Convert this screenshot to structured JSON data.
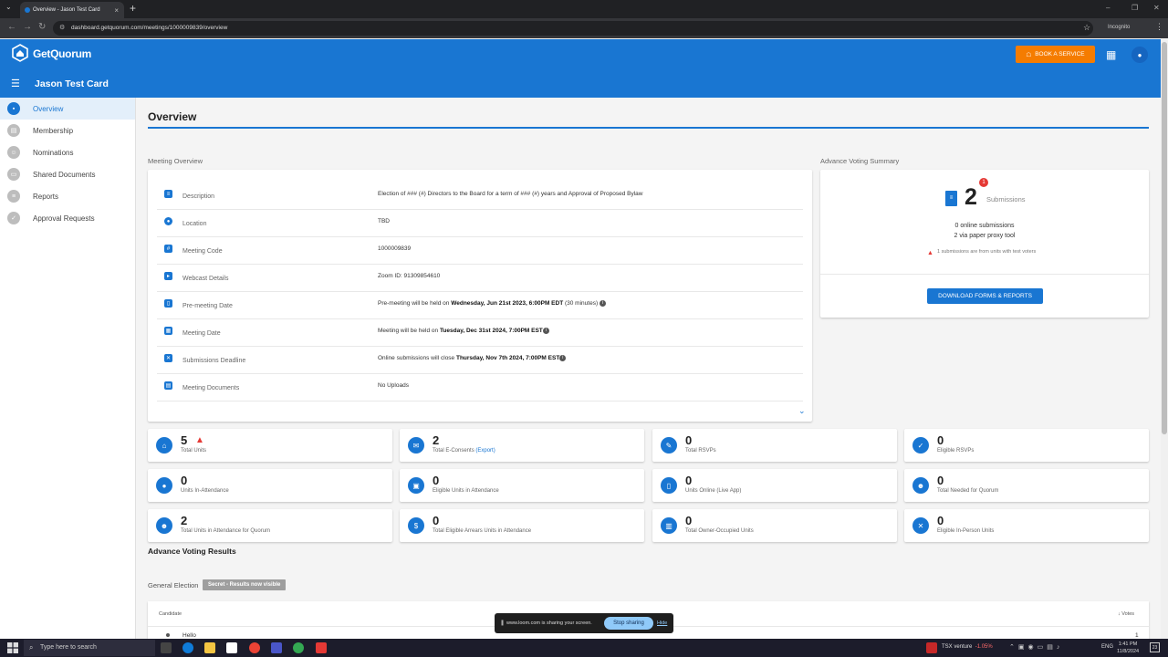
{
  "browser": {
    "tab_title": "Overview - Jason Test Card",
    "url": "dashboard.getquorum.com/meetings/1000009839/overview",
    "incognito_label": "Incognito"
  },
  "app": {
    "brand": "GetQuorum",
    "book_service_label": "BOOK A SERVICE",
    "meeting_title": "Jason Test Card",
    "brand_color": "#1976d2",
    "accent_color": "#f57c00"
  },
  "sidebar": {
    "items": [
      {
        "label": "Overview",
        "icon": "overview-icon",
        "active": true
      },
      {
        "label": "Membership",
        "icon": "membership-icon"
      },
      {
        "label": "Nominations",
        "icon": "nominations-icon"
      },
      {
        "label": "Shared Documents",
        "icon": "documents-icon"
      },
      {
        "label": "Reports",
        "icon": "reports-icon"
      },
      {
        "label": "Approval Requests",
        "icon": "thumbs-up-icon"
      }
    ]
  },
  "page": {
    "title": "Overview",
    "meeting_overview_label": "Meeting Overview",
    "advance_voting_summary_label": "Advance Voting Summary"
  },
  "overview": {
    "rows": [
      {
        "label": "Description",
        "value": "Election of ### (#) Directors to the Board for a term of ### (#) years and Approval of Proposed Bylaw"
      },
      {
        "label": "Location",
        "value": "TBD"
      },
      {
        "label": "Meeting Code",
        "value": "1000009839"
      },
      {
        "label": "Webcast Details",
        "value": "Zoom ID: 91309854610"
      },
      {
        "label": "Pre-meeting Date",
        "prefix": "Pre-meeting will be held on ",
        "bold": "Wednesday, Jun 21st 2023, 6:00PM EDT",
        "suffix": " (30 minutes) "
      },
      {
        "label": "Meeting Date",
        "prefix": "Meeting will be held on ",
        "bold": "Tuesday, Dec 31st 2024, 7:00PM EST",
        "suffix": ""
      },
      {
        "label": "Submissions Deadline",
        "prefix": "Online submissions will close ",
        "bold": "Thursday, Nov 7th 2024, 7:00PM EST",
        "suffix": ""
      },
      {
        "label": "Meeting Documents",
        "value": "No Uploads"
      }
    ]
  },
  "voting_summary": {
    "count": "2",
    "badge": "1",
    "submissions_label": "Submissions",
    "online": "0 online submissions",
    "paper": "2 via paper proxy tool",
    "warning": "1 submissions are from units with test voters",
    "download_label": "DOWNLOAD FORMS & REPORTS"
  },
  "stats": [
    {
      "value": "5",
      "label": "Total Units",
      "icon": "home-icon",
      "warning": true
    },
    {
      "value": "2",
      "label": "Total E-Consents",
      "link": "(Export)",
      "icon": "email-icon"
    },
    {
      "value": "0",
      "label": "Total RSVPs",
      "icon": "rsvp-icon"
    },
    {
      "value": "0",
      "label": "Eligible RSVPs",
      "icon": "calendar-check-icon"
    },
    {
      "value": "0",
      "label": "Units In-Attendance",
      "icon": "location-pin-icon"
    },
    {
      "value": "0",
      "label": "Eligible Units in Attendance",
      "icon": "ticket-icon"
    },
    {
      "value": "0",
      "label": "Units Online (Live App)",
      "icon": "mobile-icon"
    },
    {
      "value": "0",
      "label": "Total Needed for Quorum",
      "icon": "people-icon"
    },
    {
      "value": "2",
      "label": "Total Units in Attendance for Quorum",
      "icon": "group-icon"
    },
    {
      "value": "0",
      "label": "Total Eligible Arrears Units in Attendance",
      "icon": "dollar-off-icon"
    },
    {
      "value": "0",
      "label": "Total Owner-Occupied Units",
      "icon": "building-icon"
    },
    {
      "value": "0",
      "label": "Eligible In-Person Units",
      "icon": "no-person-icon"
    }
  ],
  "results": {
    "title": "Advance Voting Results",
    "election_label": "General Election",
    "secret_badge": "Secret - Results now visible",
    "candidate_header": "Candidate",
    "votes_header": "↓ Votes",
    "first_candidate": "Hello",
    "first_votes": "1"
  },
  "loom": {
    "text": "www.loom.com is sharing your screen.",
    "stop_label": "Stop sharing",
    "hide_label": "Hide"
  },
  "taskbar": {
    "search_placeholder": "Type here to search",
    "stock_name": "TSX venture",
    "stock_change": "-1.05%",
    "language": "ENG",
    "time": "1:41 PM",
    "date": "11/8/2024",
    "notifications": "23"
  }
}
